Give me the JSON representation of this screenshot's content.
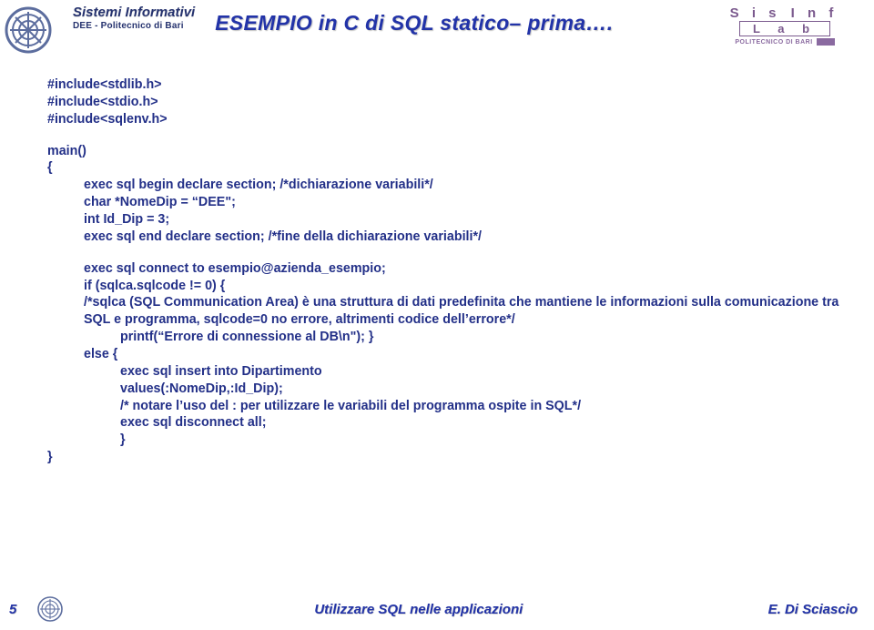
{
  "header": {
    "dept_title": "Sistemi Informativi",
    "dept_sub": "DEE - Politecnico di Bari",
    "slide_title": "ESEMPIO in C di SQL statico– prima….",
    "lab_line1": "S i s I n f",
    "lab_line2": "L a b",
    "lab_sub": "POLITECNICO DI BARI"
  },
  "code": {
    "l1": "#include<stdlib.h>",
    "l2": "#include<stdio.h>",
    "l3": "#include<sqlenv.h>",
    "l4": "main()",
    "l5": "{",
    "l6": "exec sql begin declare section; /*dichiarazione variabili*/",
    "l7": "char *NomeDip = “DEE\";",
    "l8": "int Id_Dip = 3;",
    "l9": "exec sql end declare section; /*fine della dichiarazione variabili*/",
    "l10": "exec sql connect to esempio@azienda_esempio;",
    "l11": "if (sqlca.sqlcode != 0) {",
    "l12": "/*sqlca (SQL Communication Area) è una struttura di dati predefinita che mantiene le informazioni sulla comunicazione tra SQL e programma, sqlcode=0 no errore, altrimenti codice dell’errore*/",
    "l13": "printf(“Errore di connessione al DB\\n\"); }",
    "l14": "else {",
    "l15": "exec sql insert into Dipartimento",
    "l16": "values(:NomeDip,:Id_Dip);",
    "l17": "/* notare l’uso del : per utilizzare le variabili del programma ospite in SQL*/",
    "l18": "exec sql disconnect all;",
    "l19": "}",
    "l20": "}"
  },
  "footer": {
    "page": "5",
    "title": "Utilizzare SQL nelle applicazioni",
    "author": "E. Di Sciascio"
  }
}
